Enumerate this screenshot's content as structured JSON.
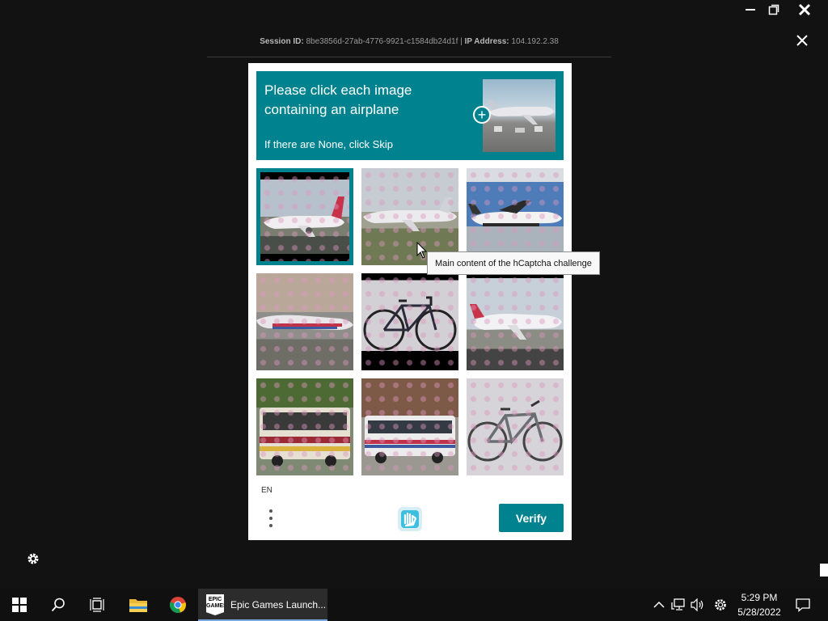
{
  "window": {
    "minimize_icon": "minimize-icon",
    "restore_icon": "restore-icon",
    "close_icon": "close-icon"
  },
  "session": {
    "id_label": "Session ID:",
    "id_value": "8be3856d-27ab-4776-9921-c1584db24d1f",
    "separator": "|",
    "ip_label": "IP Address:",
    "ip_value": "104.192.2.38"
  },
  "captcha": {
    "prompt_title": "Please click each image containing an airplane",
    "prompt_sub": "If there are None, click Skip",
    "plus_symbol": "+",
    "tiles": [
      {
        "subject": "airplane",
        "selected": true
      },
      {
        "subject": "airplane",
        "selected": false
      },
      {
        "subject": "airplane",
        "selected": false
      },
      {
        "subject": "airplane",
        "selected": false
      },
      {
        "subject": "bicycle",
        "selected": false
      },
      {
        "subject": "airplane",
        "selected": false
      },
      {
        "subject": "bus",
        "selected": false
      },
      {
        "subject": "bus",
        "selected": false
      },
      {
        "subject": "bicycle",
        "selected": false
      }
    ],
    "language": "EN",
    "verify_label": "Verify"
  },
  "tooltip": "Main content of the hCaptcha challenge",
  "taskbar": {
    "app_label": "Epic Games Launch...",
    "epic_logo_text": "EPIC GAMES",
    "time": "5:29 PM",
    "date": "5/28/2022"
  },
  "colors": {
    "accent": "#00838f",
    "background": "#121212",
    "taskbar": "#101010"
  }
}
